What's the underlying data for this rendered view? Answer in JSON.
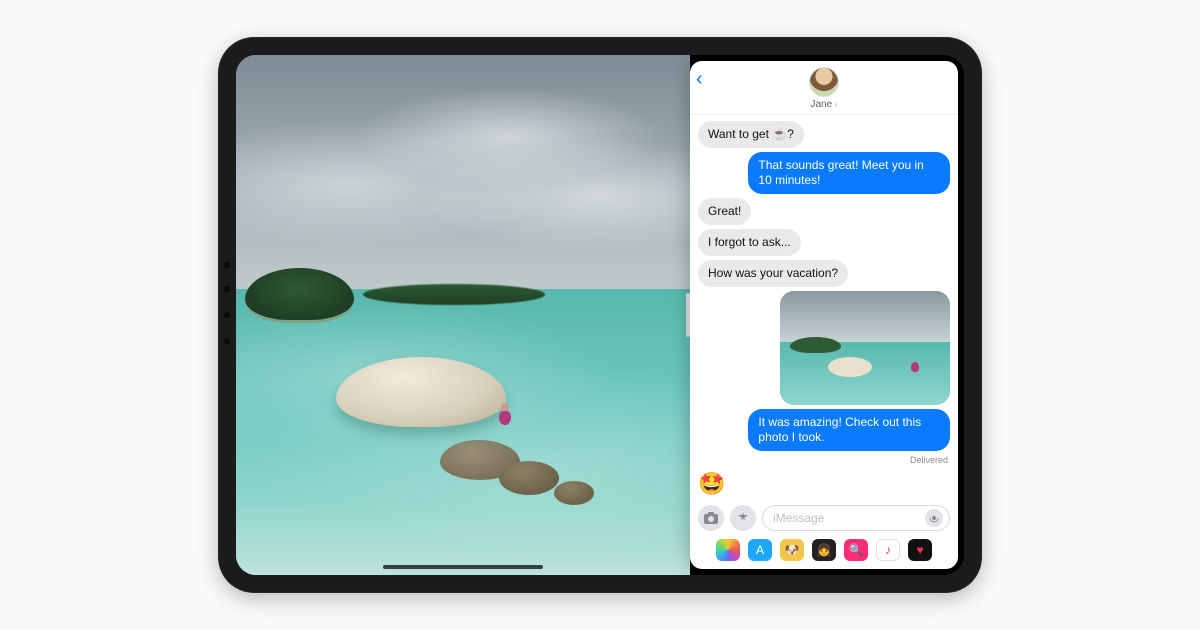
{
  "contact": {
    "name": "Jane"
  },
  "messages": {
    "m0": "Want to get ☕️?",
    "m1": "That sounds great! Meet you in 10 minutes!",
    "m2": "Great!",
    "m3": "I forgot to ask...",
    "m4": "How was your vacation?",
    "m5_photo_alt": "Beach vacation photo",
    "m6": "It was amazing! Check out this photo I took.",
    "delivered": "Delivered",
    "reaction": "🤩"
  },
  "compose": {
    "placeholder": "iMessage"
  },
  "icons": {
    "back": "‹",
    "contact_chevron": "›",
    "camera": "📷",
    "appstore": "✱",
    "mic": "((•))",
    "photos": " ",
    "store": "A",
    "animal": "🐶",
    "memoji": "👧",
    "search": "🔍",
    "music": "♪",
    "thumbs": "♥"
  }
}
